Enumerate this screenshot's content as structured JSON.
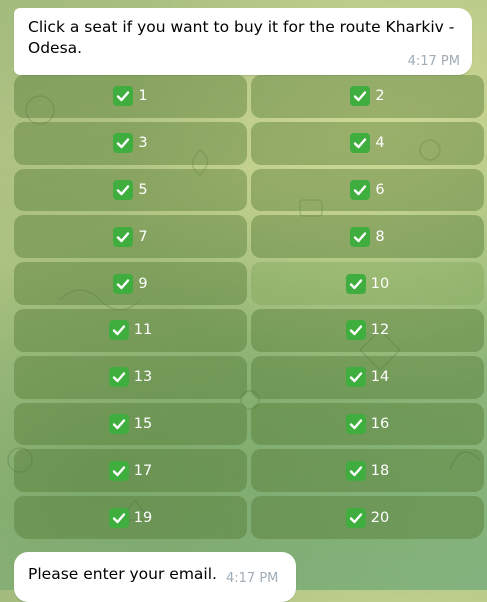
{
  "messages": {
    "route_prompt": {
      "text": "Click a seat if you want to buy it for the route Kharkiv - Odesa.",
      "time": "4:17 PM"
    },
    "email_prompt": {
      "text": "Please enter your email.",
      "time": "4:17 PM"
    }
  },
  "seats": [
    "1",
    "2",
    "3",
    "4",
    "5",
    "6",
    "7",
    "8",
    "9",
    "10",
    "11",
    "12",
    "13",
    "14",
    "15",
    "16",
    "17",
    "18",
    "19",
    "20"
  ],
  "icons": {
    "seat_status": "check-mark-button-icon"
  },
  "colors": {
    "bubble": "#ffffff",
    "seat_button": "#5a7a35",
    "check_green": "#3fae3f",
    "time": "#a0acb6"
  }
}
